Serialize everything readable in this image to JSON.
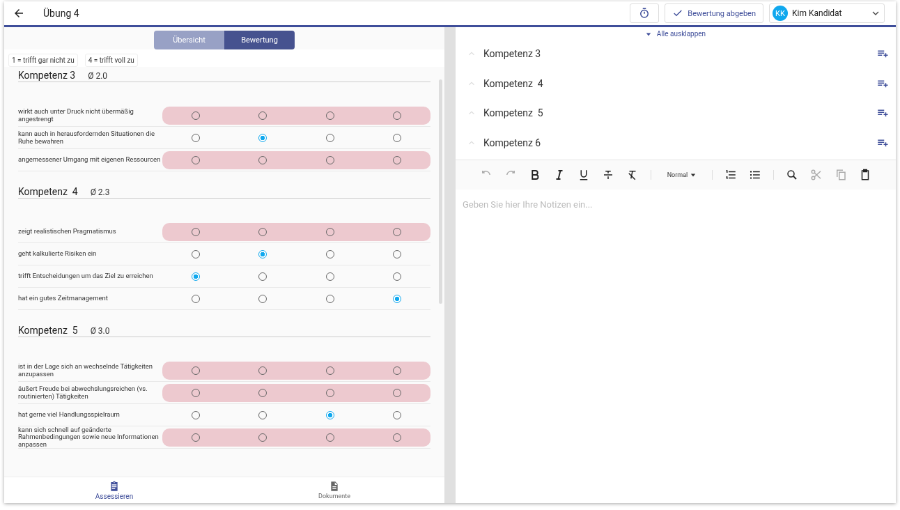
{
  "header": {
    "title": "Übung 4",
    "submit_label": "Bewertung abgeben",
    "user": {
      "initials": "KK",
      "name": "Kim Kandidat"
    }
  },
  "view_tabs": [
    {
      "label": "Übersicht",
      "selected": false
    },
    {
      "label": "Bewertung",
      "selected": true
    }
  ],
  "scale_legend": [
    "1 = trifft gar nicht zu",
    "4 = trifft voll zu"
  ],
  "competencies": [
    {
      "title": "Kompetenz 3",
      "average": "Ø 2.0",
      "items": [
        {
          "text": "wirkt auch unter Druck nicht übermäßig angestrengt",
          "options": [
            {
              "selected": false
            },
            {
              "selected": false
            },
            {
              "selected": false
            },
            {
              "selected": false
            }
          ]
        },
        {
          "text": "kann auch in herausfordernden Situationen die Ruhe bewahren",
          "options": [
            {
              "selected": false
            },
            {
              "selected": true
            },
            {
              "selected": false
            },
            {
              "selected": false
            }
          ]
        },
        {
          "text": "angemessener Umgang mit eigenen Ressourcen",
          "options": [
            {
              "selected": false
            },
            {
              "selected": false
            },
            {
              "selected": false
            },
            {
              "selected": false
            }
          ]
        }
      ]
    },
    {
      "title": "Kompetenz  4",
      "average": "Ø 2.3",
      "items": [
        {
          "text": "zeigt realistischen Pragmatismus",
          "options": [
            {
              "selected": false
            },
            {
              "selected": false
            },
            {
              "selected": false
            },
            {
              "selected": false
            }
          ]
        },
        {
          "text": "geht kalkulierte Risiken ein",
          "options": [
            {
              "selected": false
            },
            {
              "selected": true
            },
            {
              "selected": false
            },
            {
              "selected": false
            }
          ]
        },
        {
          "text": "trifft Entscheidungen um das Ziel zu erreichen",
          "options": [
            {
              "selected": true
            },
            {
              "selected": false
            },
            {
              "selected": false
            },
            {
              "selected": false
            }
          ]
        },
        {
          "text": "hat ein gutes Zeitmanagement",
          "options": [
            {
              "selected": false
            },
            {
              "selected": false
            },
            {
              "selected": false
            },
            {
              "selected": true
            }
          ]
        }
      ]
    },
    {
      "title": "Kompetenz  5",
      "average": "Ø 3.0",
      "items": [
        {
          "text": "ist in der Lage sich an wechselnde Tätigkeiten anzupassen",
          "options": [
            {
              "selected": false
            },
            {
              "selected": false
            },
            {
              "selected": false
            },
            {
              "selected": false
            }
          ]
        },
        {
          "text": "äußert Freude bei abwechslungsreichen (vs. routinierten) Tätigkeiten",
          "options": [
            {
              "selected": false
            },
            {
              "selected": false
            },
            {
              "selected": false
            },
            {
              "selected": false
            }
          ]
        },
        {
          "text": "hat gerne viel Handlungsspielraum",
          "options": [
            {
              "selected": false
            },
            {
              "selected": false
            },
            {
              "selected": true
            },
            {
              "selected": false
            }
          ]
        },
        {
          "text": "kann sich schnell auf geänderte Rahmenbedingungen sowie neue Informationen anpassen",
          "options": [
            {
              "selected": false
            },
            {
              "selected": false
            },
            {
              "selected": false
            },
            {
              "selected": false
            }
          ]
        }
      ]
    }
  ],
  "bottom_nav": [
    {
      "label": "Assessieren",
      "selected": true,
      "kind": "clipboard"
    },
    {
      "label": "Dokumente",
      "selected": false,
      "kind": "document"
    }
  ],
  "notes": {
    "expand_all": "Alle ausklappen",
    "sections": [
      {
        "title": "Kompetenz 3",
        "expanded": false
      },
      {
        "title": "Kompetenz  4",
        "expanded": false
      },
      {
        "title": "Kompetenz  5",
        "expanded": false
      },
      {
        "title": "Kompetenz 6",
        "expanded": false
      }
    ],
    "format_label": "Normal",
    "placeholder": "Geben Sie hier Ihre Notizen ein..."
  }
}
